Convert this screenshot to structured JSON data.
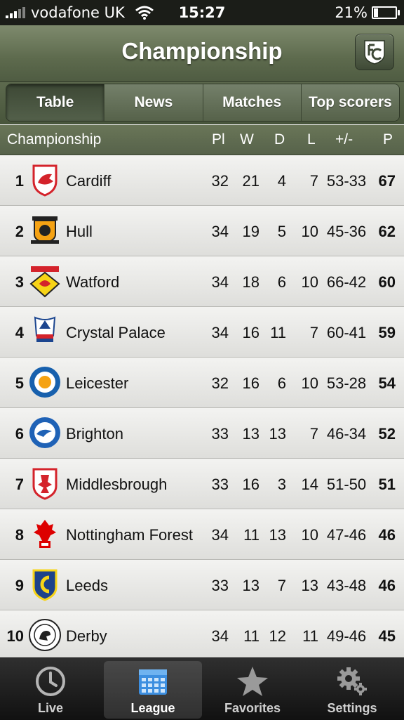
{
  "status_bar": {
    "carrier": "vodafone UK",
    "time": "15:27",
    "battery": "21%"
  },
  "nav": {
    "title": "Championship",
    "fc_icon": "club-badge-icon"
  },
  "segments": [
    {
      "label": "Table",
      "active": true
    },
    {
      "label": "News",
      "active": false
    },
    {
      "label": "Matches",
      "active": false
    },
    {
      "label": "Top scorers",
      "active": false
    }
  ],
  "table": {
    "league": "Championship",
    "columns": {
      "played": "Pl",
      "won": "W",
      "drawn": "D",
      "lost": "L",
      "goals": "+/-",
      "points": "P"
    },
    "rows": [
      {
        "pos": "1",
        "team": "Cardiff",
        "pl": "32",
        "w": "21",
        "d": "4",
        "l": "7",
        "gd": "53-33",
        "pts": "67",
        "crest_color": "#d4232b"
      },
      {
        "pos": "2",
        "team": "Hull",
        "pl": "34",
        "w": "19",
        "d": "5",
        "l": "10",
        "gd": "45-36",
        "pts": "62",
        "crest_color": "#f5a213"
      },
      {
        "pos": "3",
        "team": "Watford",
        "pl": "34",
        "w": "18",
        "d": "6",
        "l": "10",
        "gd": "66-42",
        "pts": "60",
        "crest_color": "#f7d417"
      },
      {
        "pos": "4",
        "team": "Crystal Palace",
        "pl": "34",
        "w": "16",
        "d": "11",
        "l": "7",
        "gd": "60-41",
        "pts": "59",
        "crest_color": "#1b458f"
      },
      {
        "pos": "5",
        "team": "Leicester",
        "pl": "32",
        "w": "16",
        "d": "6",
        "l": "10",
        "gd": "53-28",
        "pts": "54",
        "crest_color": "#1760ad"
      },
      {
        "pos": "6",
        "team": "Brighton",
        "pl": "33",
        "w": "13",
        "d": "13",
        "l": "7",
        "gd": "46-34",
        "pts": "52",
        "crest_color": "#1f62b6"
      },
      {
        "pos": "7",
        "team": "Middlesbrough",
        "pl": "33",
        "w": "16",
        "d": "3",
        "l": "14",
        "gd": "51-50",
        "pts": "51",
        "crest_color": "#d4232b"
      },
      {
        "pos": "8",
        "team": "Nottingham Forest",
        "pl": "34",
        "w": "11",
        "d": "13",
        "l": "10",
        "gd": "47-46",
        "pts": "46",
        "crest_color": "#dd0000"
      },
      {
        "pos": "9",
        "team": "Leeds",
        "pl": "33",
        "w": "13",
        "d": "7",
        "l": "13",
        "gd": "43-48",
        "pts": "46",
        "crest_color": "#1d428a"
      },
      {
        "pos": "10",
        "team": "Derby",
        "pl": "34",
        "w": "11",
        "d": "12",
        "l": "11",
        "gd": "49-46",
        "pts": "45",
        "crest_color": "#222222"
      }
    ]
  },
  "tabbar": [
    {
      "label": "Live",
      "icon": "clock-icon",
      "active": false
    },
    {
      "label": "League",
      "icon": "calendar-icon",
      "active": true
    },
    {
      "label": "Favorites",
      "icon": "star-icon",
      "active": false
    },
    {
      "label": "Settings",
      "icon": "gear-icon",
      "active": false
    }
  ]
}
